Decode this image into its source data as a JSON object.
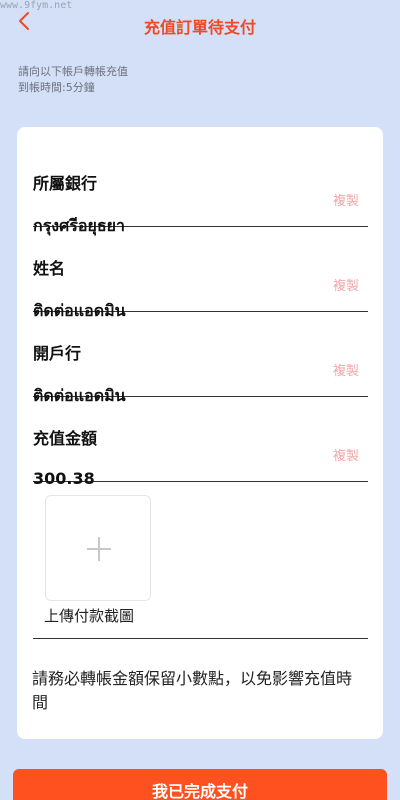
{
  "watermark": "www.9fym.net",
  "header": {
    "back_icon": "chevron-left-icon",
    "title": "充值訂單待支付"
  },
  "instructions": {
    "line1": "請向以下帳戶轉帳充值",
    "line2": "到帳時間:5分鐘"
  },
  "fields": [
    {
      "label": "所屬銀行",
      "value": "กรุงศรีอยุธยา",
      "copy": "複製"
    },
    {
      "label": "姓名",
      "value": "ติดต่อแอดมิน",
      "copy": "複製"
    },
    {
      "label": "開戶行",
      "value": "ติดต่อแอดมิน",
      "copy": "複製"
    },
    {
      "label": "充值金額",
      "value": "300.38",
      "copy": "複製"
    }
  ],
  "upload": {
    "icon": "plus-icon",
    "label": "上傳付款截圖"
  },
  "notice": "請務必轉帳金額保留小數點，以免影響充值時間",
  "submit_label": "我已完成支付",
  "colors": {
    "accent": "#ef4a24",
    "button": "#ff5020",
    "copy": "#f2a6a6",
    "background": "#d4e0f7"
  }
}
